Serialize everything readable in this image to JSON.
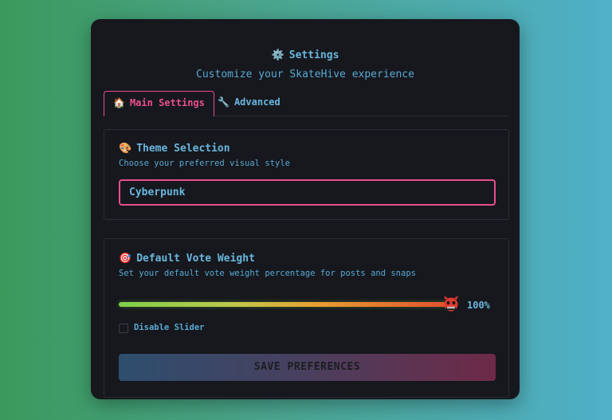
{
  "header": {
    "title": "Settings",
    "title_icon": "⚙️",
    "subtitle": "Customize your SkateHive experience"
  },
  "tabs": [
    {
      "label": "Main Settings",
      "icon": "🏠",
      "active": true
    },
    {
      "label": "Advanced",
      "icon": "🔧",
      "active": false
    }
  ],
  "theme": {
    "icon": "🎨",
    "title": "Theme Selection",
    "description": "Choose your preferred visual style",
    "selected": "Cyberpunk"
  },
  "vote": {
    "icon": "🎯",
    "title": "Default Vote Weight",
    "description": "Set your default vote weight percentage for posts and snaps",
    "value_label": "100%",
    "value_fraction": 1.0,
    "disable_label": "Disable Slider",
    "disabled": false
  },
  "actions": {
    "save_label": "SAVE PREFERENCES"
  },
  "colors": {
    "accent_pink": "#e84f8c",
    "accent_blue": "#6ab6de",
    "panel_bg": "#16181d"
  }
}
